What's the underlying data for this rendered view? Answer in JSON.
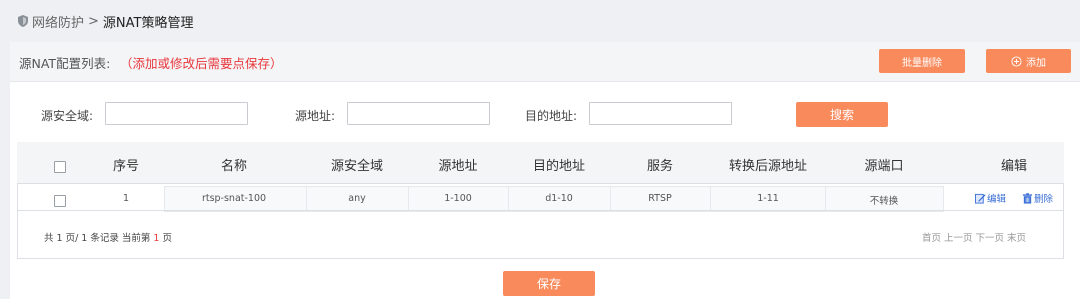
{
  "breadcrumb": {
    "parent": "网络防护",
    "separator": ">",
    "current": "源NAT策略管理"
  },
  "list": {
    "title": "源NAT配置列表:",
    "note": "（添加或修改后需要点保存）",
    "batch_delete_label": "批量删除",
    "add_label": "添加"
  },
  "search": {
    "src_zone_label": "源安全域:",
    "src_addr_label": "源地址:",
    "dst_addr_label": "目的地址:",
    "src_zone_value": "",
    "src_addr_value": "",
    "dst_addr_value": "",
    "button_label": "搜索"
  },
  "table": {
    "columns": [
      "序号",
      "名称",
      "源安全域",
      "源地址",
      "目的地址",
      "服务",
      "转换后源地址",
      "源端口",
      "编辑"
    ],
    "rows": [
      {
        "index": "1",
        "name": "rtsp-snat-100",
        "src_zone": "any",
        "src_addr": "1-100",
        "dst_addr": "d1-10",
        "service": "RTSP",
        "translated_src": "1-11",
        "src_port": "不转换",
        "edit_label": "编辑",
        "delete_label": "删除"
      }
    ]
  },
  "pager": {
    "prefix": "共 1 页/ 1 条记录 当前第",
    "current_page": "1",
    "suffix": "页",
    "first": "首页",
    "prev": "上一页",
    "next": "下一页",
    "last": "末页"
  },
  "save_label": "保存",
  "colors": {
    "accent": "#f98a5c",
    "warning": "#e8383d",
    "link": "#3a6fd8"
  }
}
